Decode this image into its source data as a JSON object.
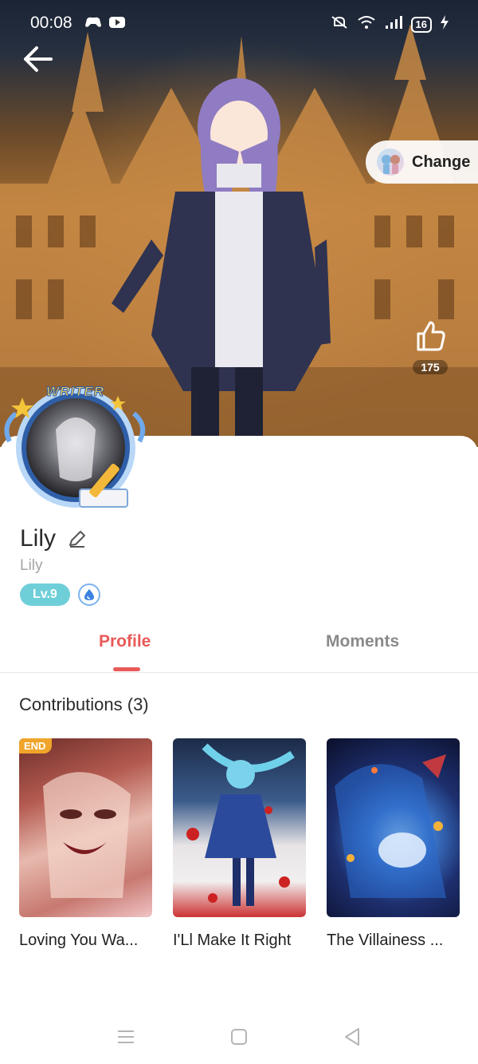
{
  "status_bar": {
    "time": "00:08",
    "battery": "16"
  },
  "header": {
    "change_label": "Change",
    "likes": "175"
  },
  "profile": {
    "badge_text": "WRITER",
    "name": "Lily",
    "handle": "Lily",
    "level": "Lv.9"
  },
  "tabs": [
    {
      "label": "Profile",
      "active": true
    },
    {
      "label": "Moments",
      "active": false
    }
  ],
  "contributions": {
    "title": "Contributions (3)",
    "books": [
      {
        "title": "Loving You Wa...",
        "tag": "END"
      },
      {
        "title": "I'Ll Make It Right",
        "tag": ""
      },
      {
        "title": "The Villainess ...",
        "tag": ""
      }
    ]
  },
  "colors": {
    "accent": "#e85a58",
    "level_badge": "#6fcfd9",
    "end_tag": "#f0a52a"
  }
}
